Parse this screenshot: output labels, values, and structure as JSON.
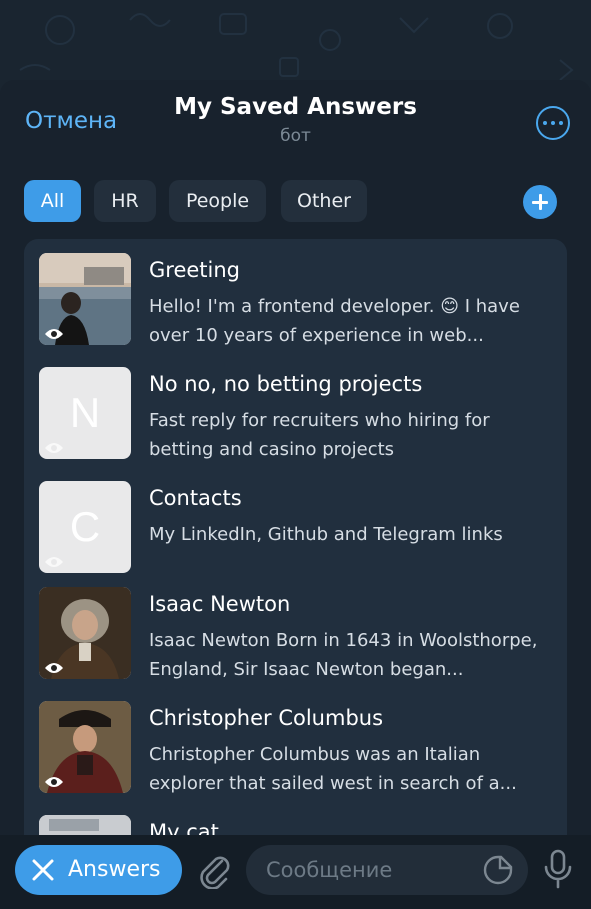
{
  "header": {
    "cancel_label": "Отмена",
    "title": "My Saved Answers",
    "subtitle": "бот",
    "more_icon": "more-dots-icon"
  },
  "tabs": [
    {
      "label": "All",
      "active": true
    },
    {
      "label": "HR",
      "active": false
    },
    {
      "label": "People",
      "active": false
    },
    {
      "label": "Other",
      "active": false
    }
  ],
  "add_icon": "plus-icon",
  "items": [
    {
      "title": "Greeting",
      "desc": "Hello! I'm a frontend developer. 😊 I have over 10 years of experience in web...",
      "thumb": "photo",
      "letter": ""
    },
    {
      "title": "No no, no betting projects",
      "desc": "Fast reply for recruiters who hiring for betting and casino projects",
      "thumb": "letter",
      "letter": "N"
    },
    {
      "title": "Contacts",
      "desc": "My LinkedIn, Github and Telegram links",
      "thumb": "letter",
      "letter": "C"
    },
    {
      "title": "Isaac Newton",
      "desc": "Isaac Newton Born in 1643 in Woolsthorpe, England, Sir Isaac Newton began...",
      "thumb": "photo",
      "letter": ""
    },
    {
      "title": "Christopher Columbus",
      "desc": "Christopher Columbus was an Italian explorer that sailed west in search of a...",
      "thumb": "photo",
      "letter": ""
    },
    {
      "title": "My cat",
      "desc": "",
      "thumb": "photo",
      "letter": ""
    }
  ],
  "bottom": {
    "answers_label": "Answers",
    "message_placeholder": "Сообщение"
  },
  "colors": {
    "accent": "#3e9ce8",
    "link": "#5eb5f7",
    "background": "#18222d",
    "list_bg": "#212f3e"
  }
}
